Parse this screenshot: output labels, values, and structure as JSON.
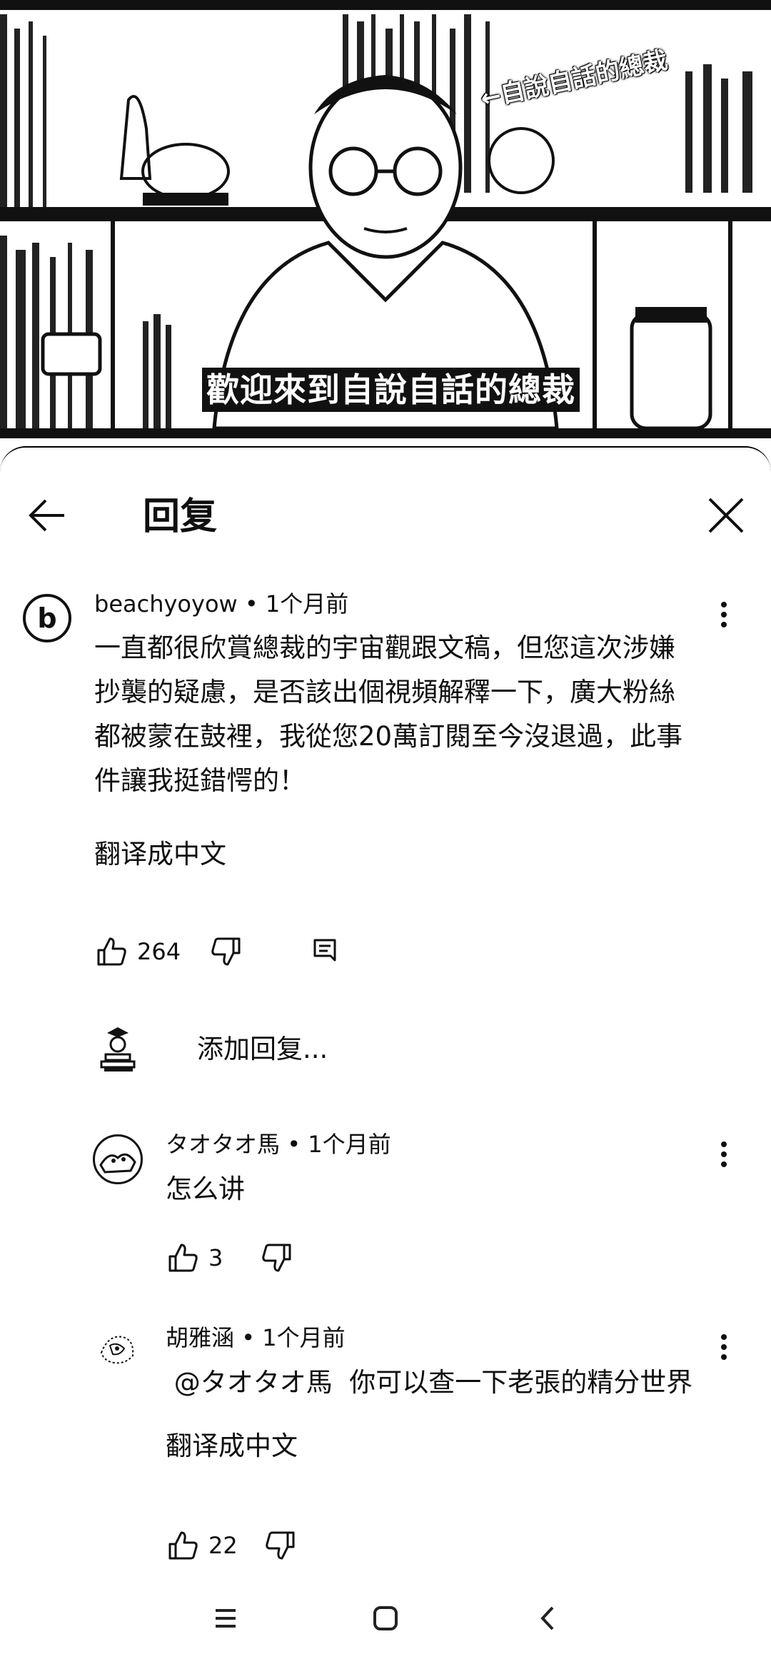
{
  "video": {
    "caption": "歡迎來到自說自話的總裁",
    "overlay_text": "←自說自話的總裁"
  },
  "header": {
    "title": "回复",
    "back_icon": "arrow-left-icon",
    "close_icon": "close-icon"
  },
  "parent_comment": {
    "avatar_letter": "b",
    "author": "beachyoyow",
    "time": "1个月前",
    "text_lines": [
      "一直都很欣賞總裁的宇宙觀跟文稿，但您這次涉嫌",
      "抄襲的疑慮，是否該出個視頻解釋一下，廣大粉絲",
      "都被蒙在鼓裡，我從您20萬訂閱至今沒退過，此事",
      "件讓我挺錯愕的！"
    ],
    "translate_label": "翻译成中文",
    "likes": "264"
  },
  "add_reply": {
    "placeholder": "添加回复..."
  },
  "replies": [
    {
      "author": "タオタオ馬",
      "time": "1个月前",
      "text": "怎么讲",
      "likes": "3"
    },
    {
      "author": "胡雅涵",
      "time": "1个月前",
      "text": " @タオタオ馬  你可以查一下老張的精分世界",
      "translate_label": "翻译成中文",
      "likes": "22"
    }
  ],
  "separator": "•",
  "navbar": {
    "menu_icon": "menu-icon",
    "home_icon": "home-square-icon",
    "back_icon": "back-chevron-icon"
  }
}
